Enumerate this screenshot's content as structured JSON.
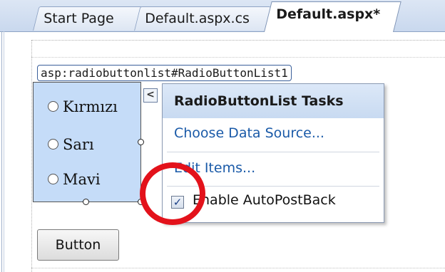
{
  "tabs": [
    {
      "label": "Start Page",
      "active": false
    },
    {
      "label": "Default.aspx.cs",
      "active": false
    },
    {
      "label": "Default.aspx*",
      "active": true
    }
  ],
  "designer": {
    "control_tag": "asp:radiobuttonlist#RadioButtonList1",
    "radio_items": [
      "Kırmızı",
      "Sarı",
      "Mavi"
    ],
    "expand_glyph": "<",
    "button_label": "Button"
  },
  "smart_tag": {
    "title": "RadioButtonList Tasks",
    "items": [
      "Choose Data Source...",
      "Edit Items..."
    ],
    "autopostback_label": "Enable AutoPostBack",
    "autopostback_checked": true,
    "check_glyph": "✓"
  },
  "colors": {
    "highlight_ring": "#e3121b",
    "link": "#1a5aa8",
    "selection_fill": "#c5dcf8"
  }
}
